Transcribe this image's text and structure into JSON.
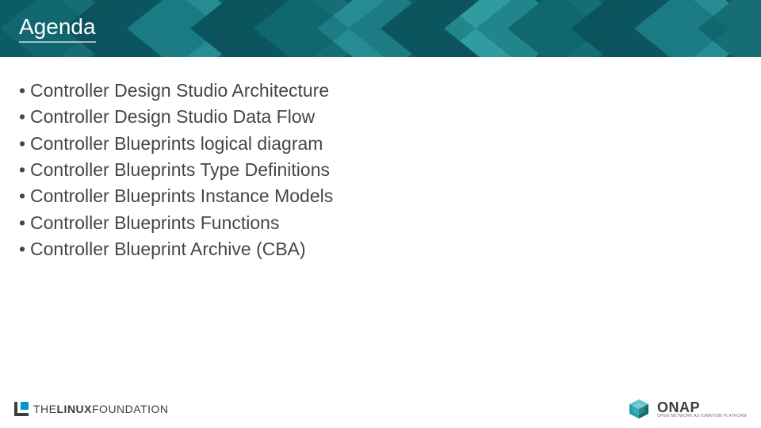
{
  "header": {
    "title": "Agenda"
  },
  "bullets": [
    "Controller Design Studio Architecture",
    "Controller Design Studio Data Flow",
    "Controller Blueprints logical diagram",
    "Controller Blueprints Type Definitions",
    "Controller Blueprints Instance Models",
    "Controller Blueprints Functions",
    "Controller Blueprint Archive (CBA)"
  ],
  "footer": {
    "linux_foundation": {
      "prefix": "THE",
      "main": "LINUX",
      "suffix": "FOUNDATION"
    },
    "onap": {
      "main": "ONAP",
      "sub": "OPEN NETWORK AUTOMATION PLATFORM"
    }
  },
  "colors": {
    "header_bg": "#0a5c66",
    "diamond_light": "#33a3a8",
    "diamond_mid": "#1f7f86",
    "diamond_dark": "#0d525b",
    "body_text": "#444648"
  }
}
